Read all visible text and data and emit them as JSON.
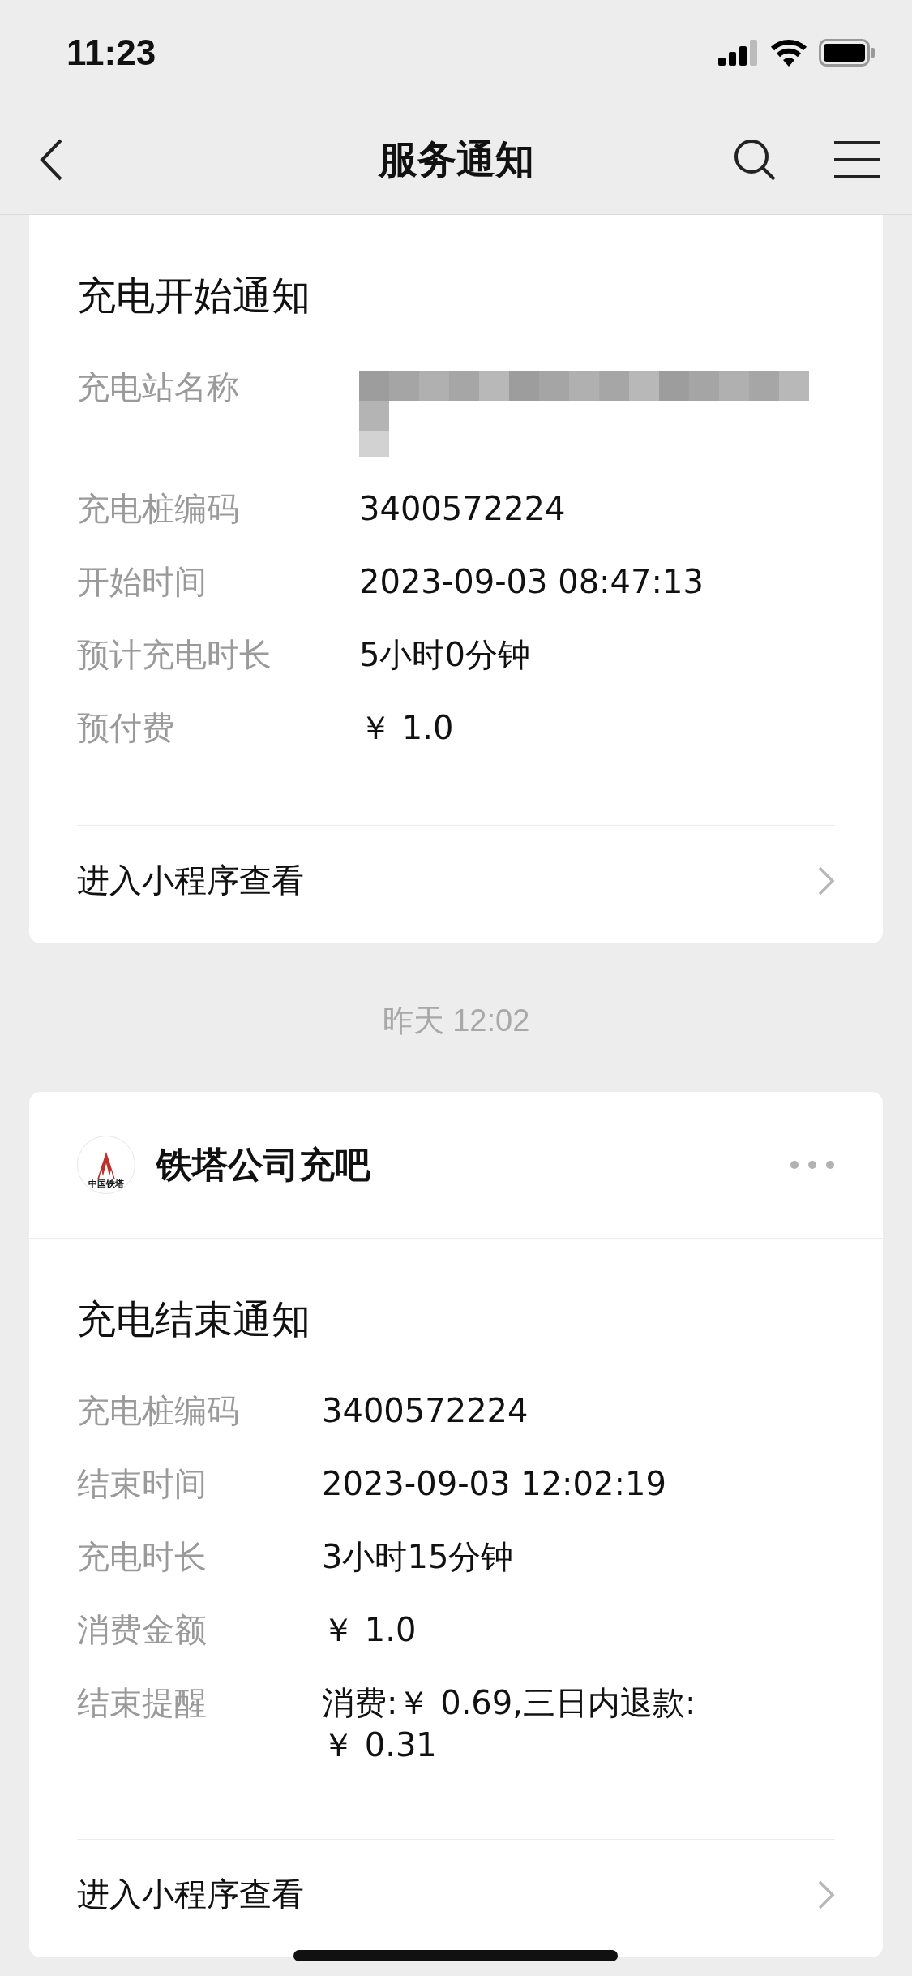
{
  "status_bar": {
    "time": "11:23"
  },
  "nav": {
    "title": "服务通知"
  },
  "messages": [
    {
      "title": "充电开始通知",
      "fields": [
        {
          "label": "充电站名称",
          "redacted": true
        },
        {
          "label": "充电桩编码",
          "value": "3400572224"
        },
        {
          "label": "开始时间",
          "value": "2023-09-03 08:47:13"
        },
        {
          "label": "预计充电时长",
          "value": "5小时0分钟"
        },
        {
          "label": "预付费",
          "value": "￥ 1.0"
        }
      ],
      "link": "进入小程序查看"
    },
    {
      "timestamp": "昨天 12:02",
      "sender": {
        "name": "铁塔公司充吧",
        "logo_text": "中国铁塔"
      },
      "title": "充电结束通知",
      "fields": [
        {
          "label": "充电桩编码",
          "value": "3400572224"
        },
        {
          "label": "结束时间",
          "value": "2023-09-03 12:02:19"
        },
        {
          "label": "充电时长",
          "value": "3小时15分钟"
        },
        {
          "label": "消费金额",
          "value": "￥ 1.0"
        },
        {
          "label": "结束提醒",
          "value": "消费:￥ 0.69,三日内退款:￥ 0.31"
        }
      ],
      "link": "进入小程序查看"
    }
  ]
}
